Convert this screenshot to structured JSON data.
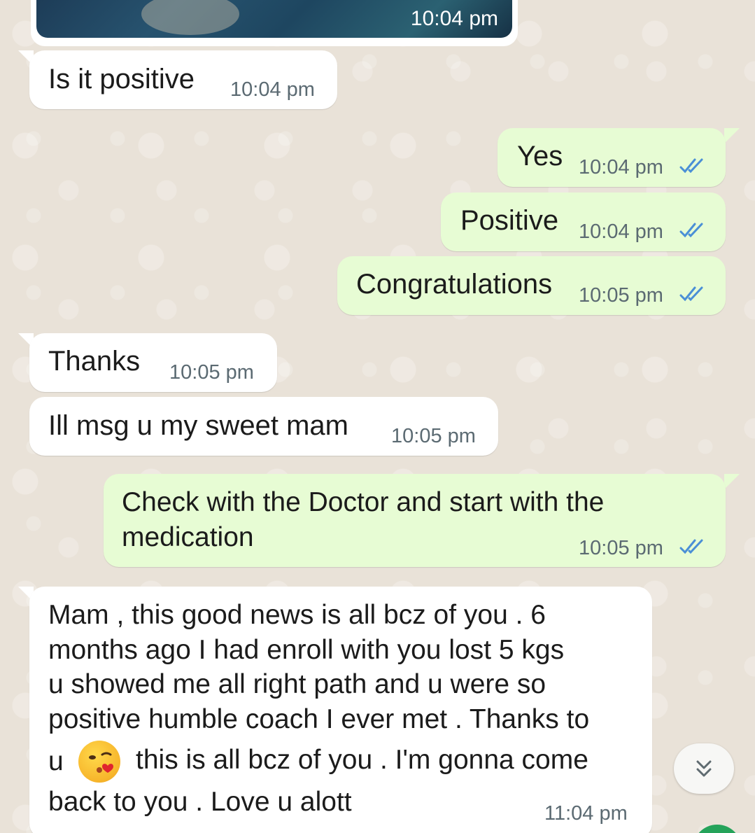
{
  "colors": {
    "incoming_bubble": "#ffffff",
    "outgoing_bubble": "#e7fcd4",
    "read_tick": "#4a8fd6",
    "timestamp": "#5b6a72",
    "wallpaper": "#e9e2d8"
  },
  "image_message": {
    "time": "10:04 pm"
  },
  "messages": [
    {
      "direction": "incoming",
      "text": "Is it positive",
      "time": "10:04 pm"
    },
    {
      "direction": "outgoing",
      "text": "Yes",
      "time": "10:04 pm",
      "status": "read-double-tick-icon"
    },
    {
      "direction": "outgoing",
      "text": "Positive",
      "time": "10:04 pm",
      "status": "read-double-tick-icon"
    },
    {
      "direction": "outgoing",
      "text": "Congratulations",
      "time": "10:05 pm",
      "status": "read-double-tick-icon"
    },
    {
      "direction": "incoming",
      "text": "Thanks",
      "time": "10:05 pm"
    },
    {
      "direction": "incoming",
      "text": "Ill msg u my sweet mam",
      "time": "10:05 pm"
    },
    {
      "direction": "outgoing",
      "lines": [
        "Check with the Doctor and start with the",
        "medication"
      ],
      "time": "10:05 pm",
      "status": "read-double-tick-icon"
    },
    {
      "direction": "incoming",
      "lines": [
        "Mam , this good news is all bcz of you . 6",
        "months ago I had enroll with you lost 5 kgs",
        "u showed me all right path and u were so",
        "positive humble coach I ever met . Thanks to",
        "u",
        "this is all bcz of you . I'm gonna come",
        "back to you . Love u alott"
      ],
      "emoji": "kissing-face-emoji",
      "time": "11:04 pm"
    }
  ],
  "scroll_button": {
    "icon": "double-chevron-down-icon"
  }
}
